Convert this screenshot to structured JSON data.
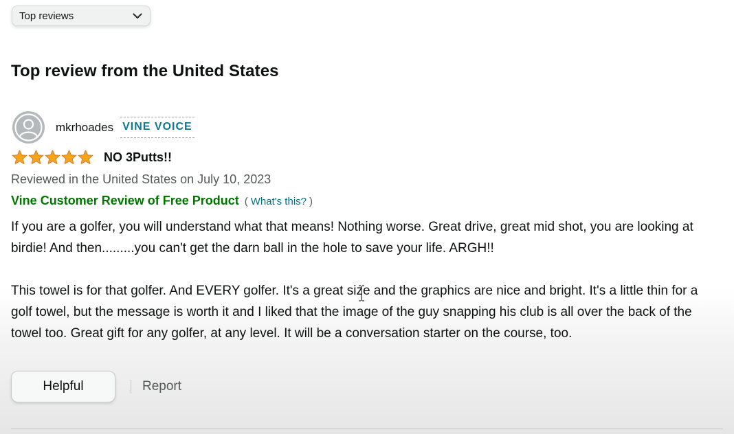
{
  "sort": {
    "selected": "Top reviews",
    "icon": "chevron-down-icon"
  },
  "section": {
    "title": "Top review from the United States"
  },
  "review": {
    "reviewer": {
      "name": "mkrhoades",
      "badge": "VINE VOICE",
      "avatar_icon": "user-avatar-icon"
    },
    "rating": 5,
    "rating_max": 5,
    "title": "NO 3Putts!!",
    "date_text": "Reviewed in the United States on July 10, 2023",
    "vine_label": "Vine Customer Review of Free Product",
    "whats_this_open": "(",
    "whats_this": "What's this?",
    "whats_this_close": ")",
    "body": [
      "If you are a golfer, you will understand what that means! Nothing worse. Great drive, great mid shot, you are looking at birdie! And then.........you can't get the darn ball in the hole to save your life. ARGH!!",
      "This towel is for that golfer. And EVERY golfer. It's a great size and the graphics are nice and bright. It's a little thin for a golf towel, but the message is worth it and I liked that the image of the guy snapping his club is all over the back of the towel too. Great gift for any golfer, at any level. It will be a conversation starter on the course, too."
    ]
  },
  "actions": {
    "helpful_label": "Helpful",
    "report_label": "Report"
  },
  "colors": {
    "star": "#f4a41d",
    "vine_badge": "#0b7a8f",
    "vine_label": "#007600",
    "link": "#007185",
    "secondary_text": "#565959"
  }
}
